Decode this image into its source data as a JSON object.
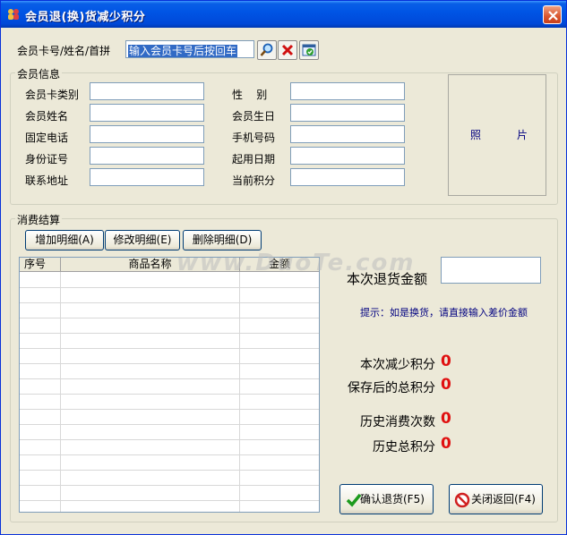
{
  "window": {
    "title": "会员退(换)货减少积分",
    "close_icon": "close-icon"
  },
  "search": {
    "label": "会员卡号/姓名/首拼",
    "value": "输入会员卡号后按回车"
  },
  "member_info": {
    "group_title": "会员信息",
    "fields": {
      "card_type": "会员卡类别",
      "name": "会员姓名",
      "phone": "固定电话",
      "id_number": "身份证号",
      "address": "联系地址",
      "gender": "性    别",
      "birthday": "会员生日",
      "mobile": "手机号码",
      "start_date": "起用日期",
      "current_points": "当前积分"
    },
    "photo_label": "照片"
  },
  "settlement": {
    "group_title": "消费结算",
    "buttons": {
      "add": "增加明细(A)",
      "edit": "修改明细(E)",
      "delete": "删除明细(D)"
    },
    "columns": [
      "序号",
      "商品名称",
      "金额"
    ],
    "return_amount_label": "本次退货金额",
    "hint": "提示：如是换货，请直接输入差价金额",
    "stats": [
      {
        "label": "本次减少积分",
        "value": "0"
      },
      {
        "label": "保存后的总积分",
        "value": "0"
      },
      {
        "label": "历史消费次数",
        "value": "0"
      },
      {
        "label": "历史总积分",
        "value": "0"
      }
    ],
    "confirm_button": "确认退货(F5)",
    "close_button": "关闭返回(F4)"
  },
  "watermark": "www.DuoTe.com",
  "colors": {
    "titlebar": "#0055e5",
    "zero_value": "#e01010",
    "hint_text": "#000080"
  }
}
